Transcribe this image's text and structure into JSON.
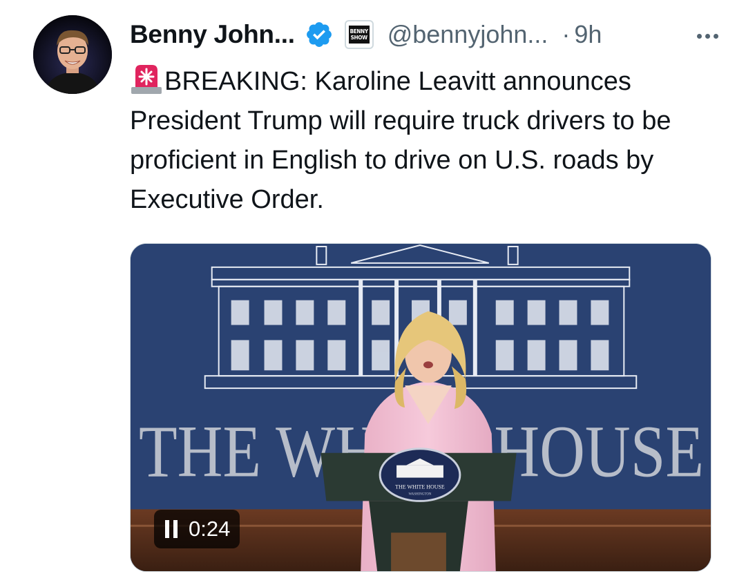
{
  "tweet": {
    "author_name": "Benny John...",
    "affiliate_badge": [
      "BENNY",
      "SHOW"
    ],
    "handle": "@bennyjohn...",
    "separator": "·",
    "time_ago": "9h",
    "siren_icon": "police-light-icon",
    "text": "BREAKING: Karoline Leavitt announces President Trump will require truck drivers to be proficient in English to drive on U.S. roads by Executive Order."
  },
  "media": {
    "type": "video",
    "state": "playing",
    "duration": "0:24",
    "backdrop_text": "THE WHITE HOUSE",
    "podium_seal_text": "THE WHITE HOUSE",
    "podium_seal_subtext": "WASHINGTON"
  },
  "colors": {
    "verified_blue": "#1d9bf0",
    "muted_text": "#536471",
    "backdrop_blue": "#2a4272",
    "jacket_pink": "#f1bfd3"
  }
}
